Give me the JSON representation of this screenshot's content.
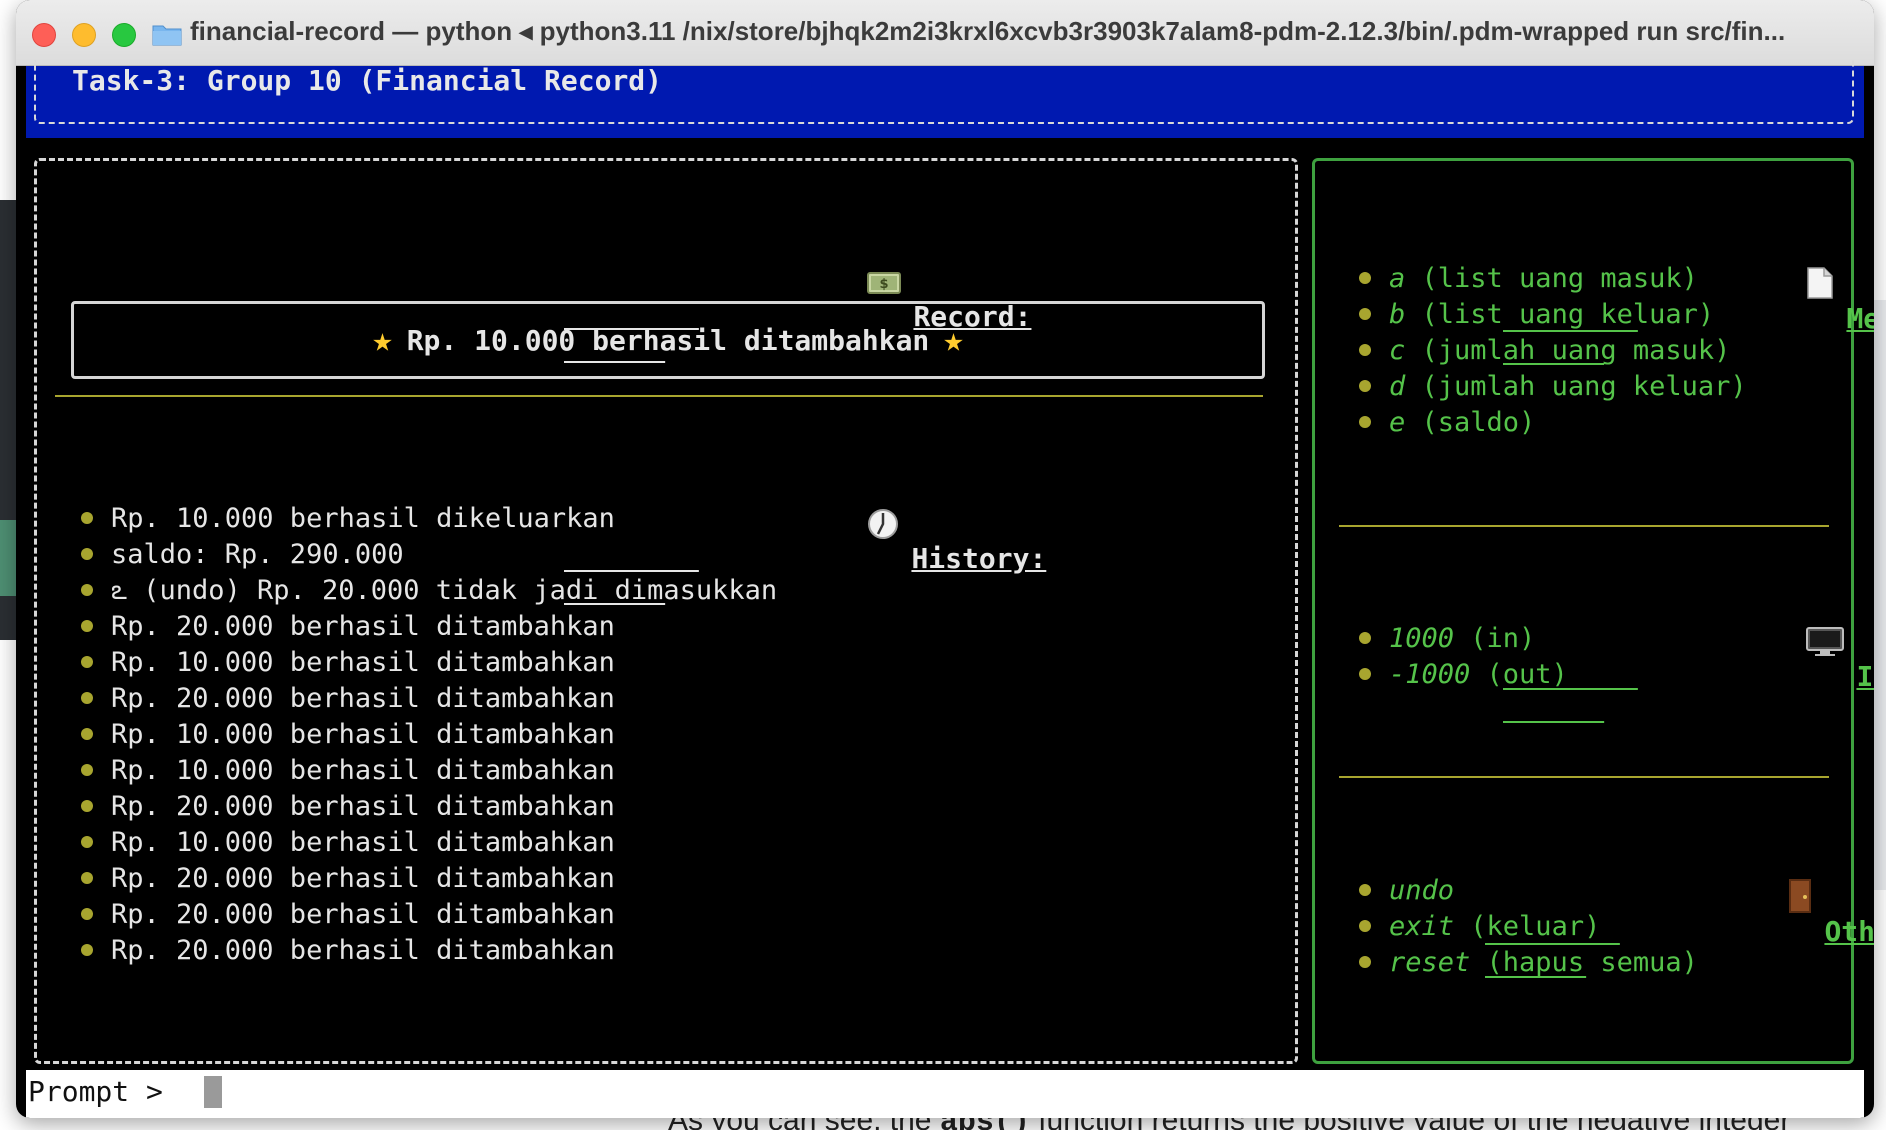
{
  "window": {
    "title": "financial-record — python ◂ python3.11 /nix/store/bjhqk2m2i3krxl6xcvb3r3903k7alam8-pdm-2.12.3/bin/.pdm-wrapped run src/fin..."
  },
  "header": {
    "title": "Task-3: Group 10 (Financial Record)"
  },
  "record": {
    "title": "Record:",
    "icon": "money-icon",
    "message": "Rp. 10.000 berhasil ditambahkan"
  },
  "history": {
    "title": "History:",
    "icon": "clock-icon",
    "items": [
      "Rp. 10.000 berhasil dikeluarkan",
      "saldo: Rp. 290.000",
      "ఽ (undo) Rp. 20.000 tidak jadi dimasukkan",
      "Rp. 20.000 berhasil ditambahkan",
      "Rp. 10.000 berhasil ditambahkan",
      "Rp. 20.000 berhasil ditambahkan",
      "Rp. 10.000 berhasil ditambahkan",
      "Rp. 10.000 berhasil ditambahkan",
      "Rp. 20.000 berhasil ditambahkan",
      "Rp. 10.000 berhasil ditambahkan",
      "Rp. 20.000 berhasil ditambahkan",
      "Rp. 20.000 berhasil ditambahkan",
      "Rp. 20.000 berhasil ditambahkan"
    ]
  },
  "menu": {
    "title": "Menu:",
    "icon": "document-icon",
    "items": [
      {
        "key": "a",
        "desc": " (list uang masuk)"
      },
      {
        "key": "b",
        "desc": " (list uang keluar)"
      },
      {
        "key": "c",
        "desc": " (jumlah uang masuk)"
      },
      {
        "key": "d",
        "desc": " (jumlah uang keluar)"
      },
      {
        "key": "e",
        "desc": " (saldo)"
      }
    ]
  },
  "input": {
    "title": "Input:",
    "icon": "computer-icon",
    "items": [
      {
        "key": "1000",
        "desc": " (in)"
      },
      {
        "key": "-1000",
        "desc": " (out)"
      }
    ]
  },
  "others": {
    "title": "Others:",
    "icon": "door-icon",
    "items": [
      {
        "key": "undo",
        "desc": ""
      },
      {
        "key": "exit",
        "desc": " (keluar)"
      },
      {
        "key": "reset",
        "desc": " (hapus semua)"
      }
    ]
  },
  "prompt": {
    "label": "Prompt > "
  },
  "background": {
    "text_before": "As you can see, the ",
    "code": "abs()",
    "text_after": " function returns the positive value of the negative integer"
  },
  "colors": {
    "header_bg": "#0019b0",
    "accent_green": "#55c34a",
    "bullet_olive": "#a8a52f",
    "star_yellow": "#ffcc2e"
  }
}
